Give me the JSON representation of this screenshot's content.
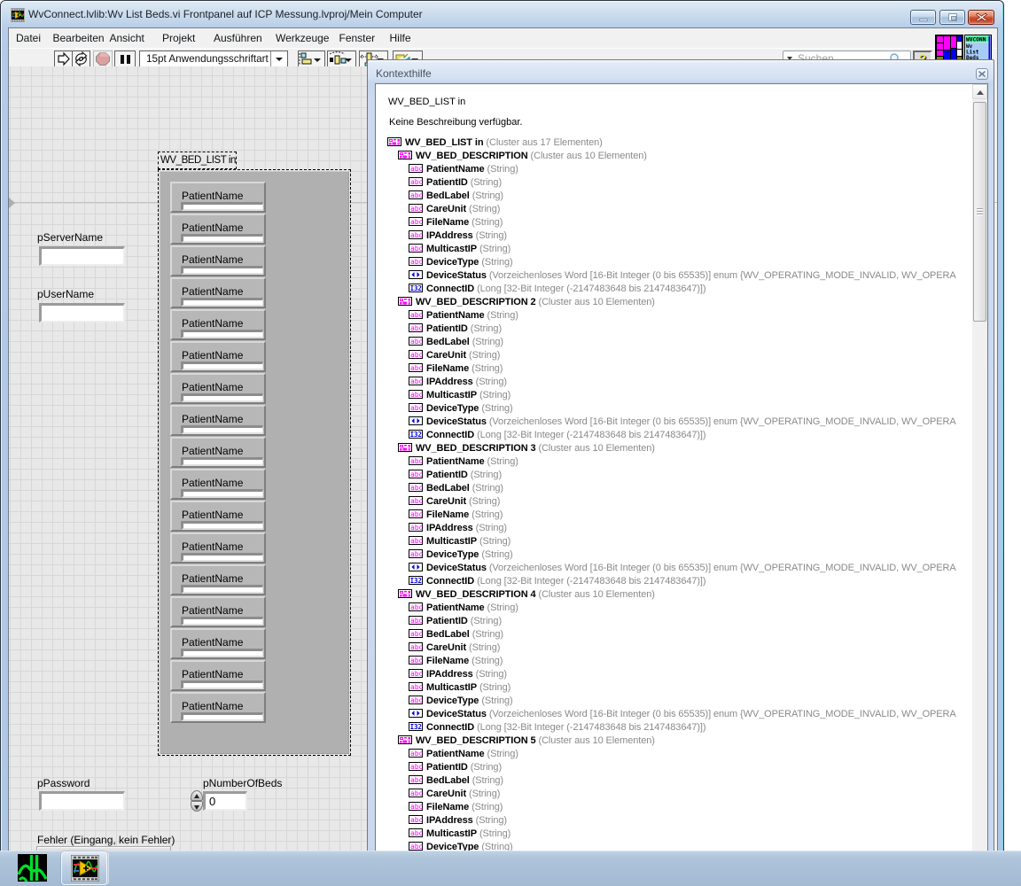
{
  "window": {
    "title": "WvConnect.lvlib:Wv List Beds.vi Frontpanel auf ICP Messung.lvproj/Mein Computer",
    "menu": [
      "Datei",
      "Bearbeiten",
      "Ansicht",
      "Projekt",
      "Ausführen",
      "Werkzeuge",
      "Fenster",
      "Hilfe"
    ],
    "toolbar": {
      "font_selector": "15pt Anwendungsschriftart",
      "search_placeholder": "Suchen",
      "help_label": "?"
    },
    "vi_icon": {
      "header": "WVCONN",
      "lines": [
        "Wv",
        "List",
        "Beds"
      ]
    }
  },
  "panel": {
    "server_label": "pServerName",
    "user_label": "pUserName",
    "password_label": "pPassword",
    "beds_label": "pNumberOfBeds",
    "beds_value": "0",
    "error_label": "Fehler (Eingang, kein Fehler)",
    "cluster_label": "WV_BED_LIST in",
    "element_label": "PatientName",
    "element_count": 17
  },
  "context_help": {
    "title": "Kontexthilfe",
    "heading": "WV_BED_LIST in",
    "description": "Keine Beschreibung verfügbar.",
    "root": {
      "icon": "cluster",
      "name": "WV_BED_LIST in",
      "type": "(Cluster aus 17 Elementen)"
    },
    "clusters": [
      {
        "icon": "cluster",
        "name": "WV_BED_DESCRIPTION",
        "type": "(Cluster aus 10 Elementen)"
      },
      {
        "icon": "cluster",
        "name": "WV_BED_DESCRIPTION 2",
        "type": "(Cluster aus 10 Elementen)"
      },
      {
        "icon": "cluster",
        "name": "WV_BED_DESCRIPTION 3",
        "type": "(Cluster aus 10 Elementen)"
      },
      {
        "icon": "cluster",
        "name": "WV_BED_DESCRIPTION 4",
        "type": "(Cluster aus 10 Elementen)"
      },
      {
        "icon": "cluster",
        "name": "WV_BED_DESCRIPTION 5",
        "type": "(Cluster aus 10 Elementen)"
      }
    ],
    "fields": [
      {
        "icon": "string",
        "name": "PatientName",
        "type": "(String)"
      },
      {
        "icon": "string",
        "name": "PatientID",
        "type": "(String)"
      },
      {
        "icon": "string",
        "name": "BedLabel",
        "type": "(String)"
      },
      {
        "icon": "string",
        "name": "CareUnit",
        "type": "(String)"
      },
      {
        "icon": "string",
        "name": "FileName",
        "type": "(String)"
      },
      {
        "icon": "string",
        "name": "IPAddress",
        "type": "(String)"
      },
      {
        "icon": "string",
        "name": "MulticastIP",
        "type": "(String)"
      },
      {
        "icon": "string",
        "name": "DeviceType",
        "type": "(String)"
      },
      {
        "icon": "enum",
        "name": "DeviceStatus",
        "type": "(Vorzeichenloses Word [16-Bit Integer (0 bis 65535)] enum {WV_OPERATING_MODE_INVALID, WV_OPERA"
      },
      {
        "icon": "i32",
        "name": "ConnectID",
        "type": "(Long [32-Bit Integer (-2147483648 bis 2147483647)])"
      }
    ]
  },
  "taskbar": {
    "items": [
      "labview-app",
      "vi-window"
    ]
  }
}
